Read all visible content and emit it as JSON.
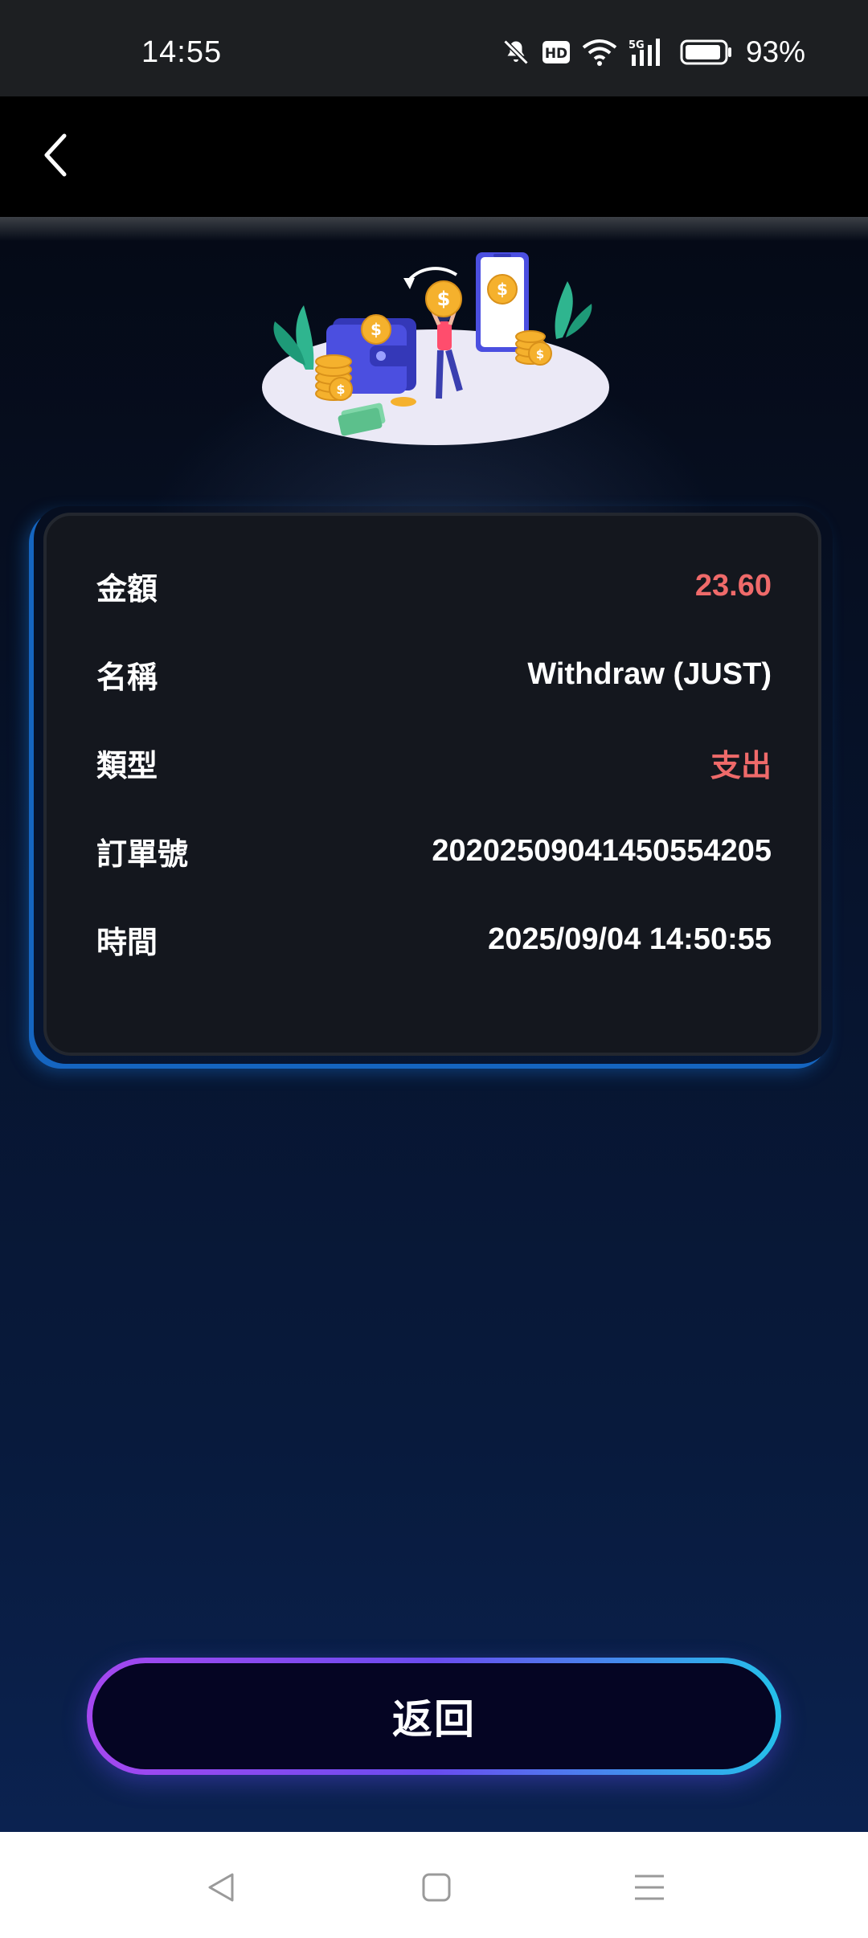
{
  "status_bar": {
    "time": "14:55",
    "battery_percent": "93%",
    "battery_level": 0.93,
    "icons": [
      "bell-off-icon",
      "hd-icon",
      "wifi-icon",
      "5g-signal-icon",
      "battery-icon"
    ]
  },
  "header": {
    "back_icon": "chevron-left-icon"
  },
  "details": [
    {
      "label": "金額",
      "value": "23.60",
      "highlight": true
    },
    {
      "label": "名稱",
      "value": "Withdraw (JUST)",
      "highlight": false
    },
    {
      "label": "類型",
      "value": "支出",
      "highlight": true
    },
    {
      "label": "訂單號",
      "value": "20202509041450554205",
      "highlight": false
    },
    {
      "label": "時間",
      "value": "2025/09/04 14:50:55",
      "highlight": false
    }
  ],
  "actions": {
    "return_label": "返回"
  },
  "nav_bar": {
    "icons": [
      "back-triangle-icon",
      "home-square-icon",
      "menu-lines-icon"
    ]
  },
  "colors": {
    "accent_red": "#ef6a6a",
    "button_gradient_start": "#a548f0",
    "button_gradient_end": "#24c1ea",
    "card_bg": "#14171e"
  }
}
